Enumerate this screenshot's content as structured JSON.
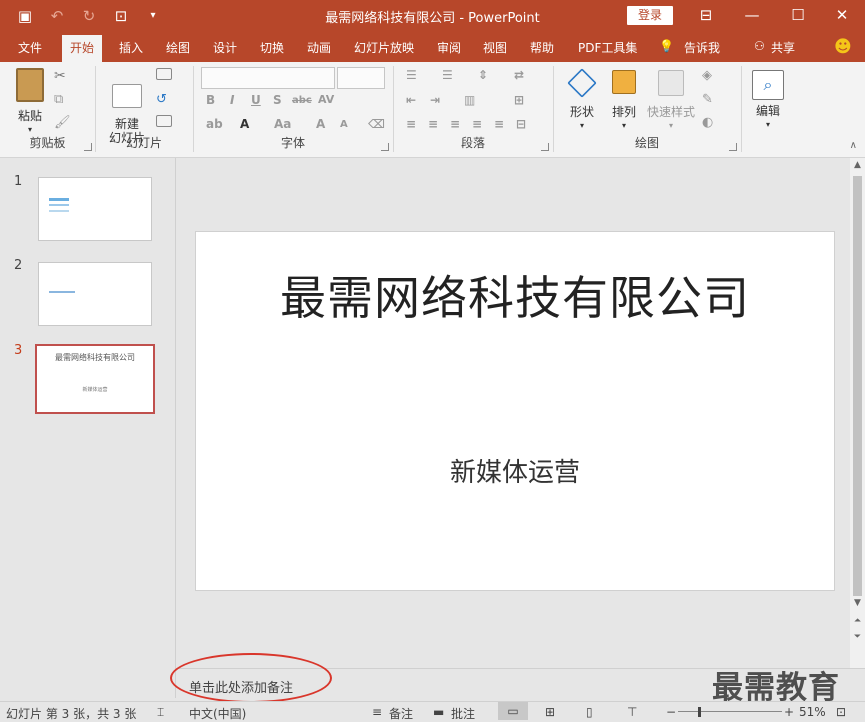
{
  "app": {
    "title": "最需网络科技有限公司  -  PowerPoint",
    "login": "登录"
  },
  "tabs": [
    "文件",
    "开始",
    "插入",
    "绘图",
    "设计",
    "切换",
    "动画",
    "幻灯片放映",
    "审阅",
    "视图",
    "帮助",
    "PDF工具集",
    "告诉我",
    "共享"
  ],
  "ribbon": {
    "paste": "粘贴",
    "clipboard": "剪贴板",
    "new_slide": "新建\n幻灯片",
    "slides": "幻灯片",
    "font": "字体",
    "paragraph": "段落",
    "shape": "形状",
    "arrange": "排列",
    "quick_styles": "快速样式",
    "drawing": "绘图",
    "editing": "编辑"
  },
  "thumbnails": [
    {
      "number": "1",
      "text": "",
      "subtext": ""
    },
    {
      "number": "2",
      "text": "",
      "subtext": ""
    },
    {
      "number": "3",
      "text": "最需网络科技有限公司",
      "subtext": "新媒体运营"
    }
  ],
  "slide": {
    "title": "最需网络科技有限公司",
    "subtitle": "新媒体运营"
  },
  "notes": {
    "placeholder": "单击此处添加备注"
  },
  "watermark": "最需教育",
  "status": {
    "slide_info": "幻灯片 第 3 张，共 3 张",
    "language": "中文(中国)",
    "notes": "备注",
    "comments": "批注",
    "zoom": "51%"
  },
  "colors": {
    "accent": "#b7472a",
    "selection": "#c0504d",
    "annotation": "#d9362b"
  }
}
